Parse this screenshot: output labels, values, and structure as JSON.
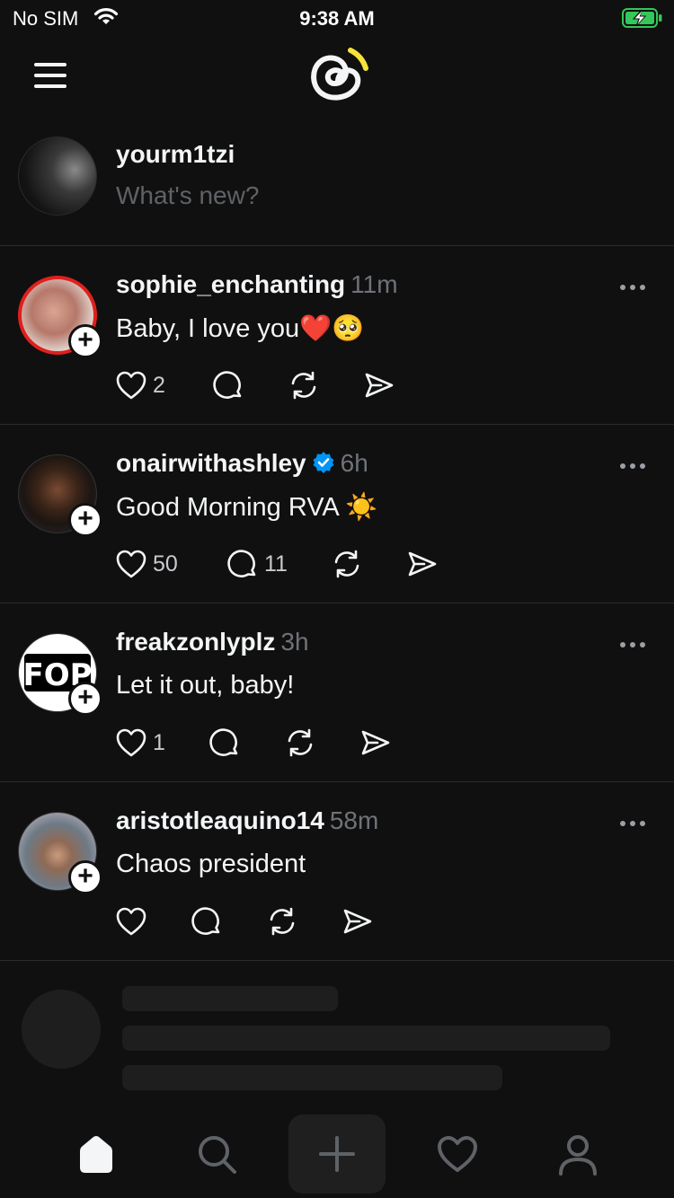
{
  "status_bar": {
    "carrier": "No SIM",
    "time": "9:38 AM"
  },
  "composer": {
    "username": "yourm1tzi",
    "placeholder": "What's new?"
  },
  "posts": [
    {
      "username": "sophie_enchanting",
      "age": "11m",
      "verified": false,
      "text": "Baby, I love you",
      "emoji": "❤️🥺",
      "likes": "2",
      "replies": ""
    },
    {
      "username": "onairwithashley",
      "age": "6h",
      "verified": true,
      "text": "Good Morning RVA",
      "emoji": "☀️",
      "likes": "50",
      "replies": "11"
    },
    {
      "username": "freakzonlyplz",
      "age": "3h",
      "verified": false,
      "text": "Let it out, baby!",
      "emoji": "",
      "likes": "1",
      "replies": ""
    },
    {
      "username": "aristotleaquino14",
      "age": "58m",
      "verified": false,
      "text": "Chaos president",
      "emoji": "",
      "likes": "",
      "replies": ""
    }
  ],
  "avatar_logo_text": "FOP",
  "icons": {
    "header": [
      "menu-icon",
      "threads-logo"
    ],
    "post_actions": [
      "heart-icon",
      "comment-icon",
      "repost-icon",
      "share-icon"
    ],
    "tabs": [
      "home-icon",
      "search-icon",
      "compose-plus-icon",
      "activity-heart-icon",
      "profile-icon"
    ]
  },
  "colors": {
    "background": "#101010",
    "text": "#f3f5f7",
    "secondary_text": "#6f7378",
    "verified_blue": "#0095f6",
    "story_ring": "#e0201d",
    "battery_green": "#34c759",
    "logo_accent": "#f5e339"
  }
}
